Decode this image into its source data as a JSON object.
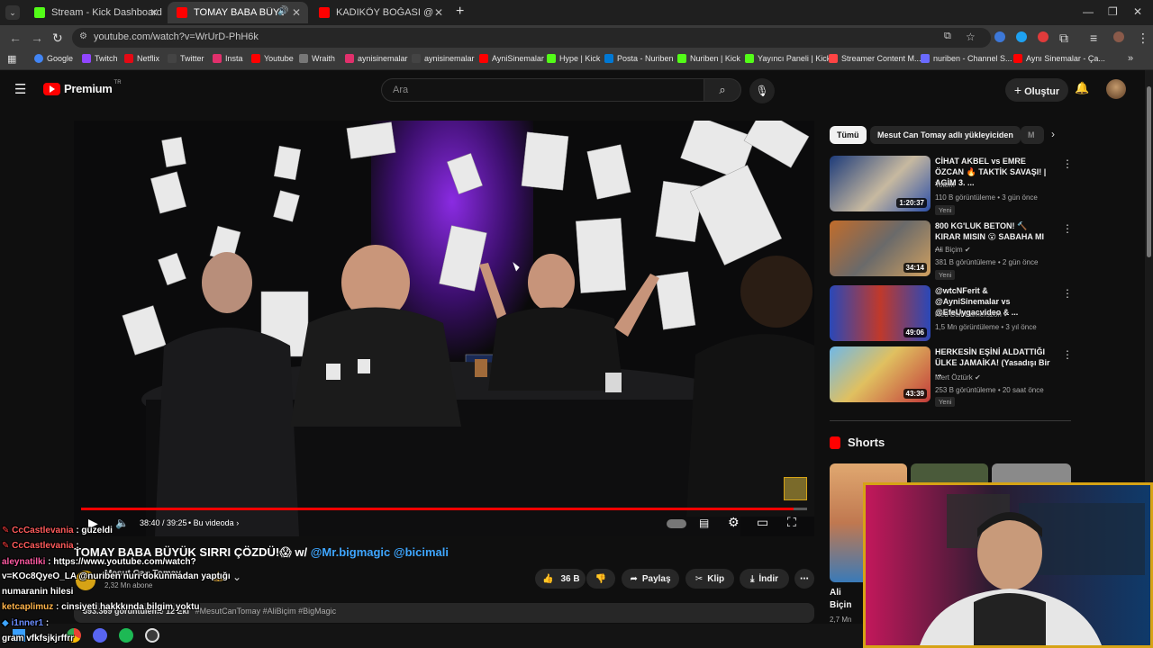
{
  "browser": {
    "tabs": [
      {
        "title": "Stream - Kick Dashboard",
        "color": "#53fc18"
      },
      {
        "title": "TOMAY BABA BÜYÜK SIRRI",
        "color": "#ff0000"
      },
      {
        "title": "KADIKÖY BOĞASI @Asitmen İl...",
        "color": "#ff0000"
      }
    ],
    "new_tab": "+",
    "url": "youtube.com/watch?v=WrUrD-PhH6k"
  },
  "bookmarks": [
    {
      "label": "Google",
      "color": "#4285f4"
    },
    {
      "label": "Twitch",
      "color": "#9146ff"
    },
    {
      "label": "Netflix",
      "color": "#e50914"
    },
    {
      "label": "Twitter",
      "color": "#dddddd"
    },
    {
      "label": "Insta",
      "color": "#e1306c"
    },
    {
      "label": "Youtube",
      "color": "#ff0000"
    },
    {
      "label": "Wraith",
      "color": "#aaaaaa"
    },
    {
      "label": "aynisinemalar",
      "color": "#e1306c"
    },
    {
      "label": "aynisinemalar",
      "color": "#dddddd"
    },
    {
      "label": "AyniSinemalar",
      "color": "#ff0000"
    },
    {
      "label": "Hype | Kick",
      "color": "#53fc18"
    },
    {
      "label": "Posta - Nuriben",
      "color": "#0078d4"
    },
    {
      "label": "Nuriben | Kick",
      "color": "#53fc18"
    },
    {
      "label": "Yayıncı Paneli | Kick",
      "color": "#53fc18"
    },
    {
      "label": "Streamer Content M...",
      "color": "#ff4444"
    },
    {
      "label": "nuriben - Channel S...",
      "color": "#6a6aff"
    },
    {
      "label": "Aynı Sinemalar - Ça...",
      "color": "#ff0000"
    }
  ],
  "youtube": {
    "logo_text": "Premium",
    "logo_super": "TR",
    "search_placeholder": "Ara",
    "create_label": "Oluştur"
  },
  "player": {
    "time": "38:40 / 39:25",
    "chapter": "Bu videoda",
    "progress_fraction": 0.981
  },
  "video": {
    "title_plain": "TOMAY BABA BÜYÜK SIRRI ÇÖZDÜ!😱 w/",
    "title_links": "@Mr.bigmagic @bicimali",
    "channel": "Mesut Can Tomay",
    "subs": "2,32 Mn abone",
    "likes": "36 B",
    "share": "Paylaş",
    "clip": "Klip",
    "download": "İndir",
    "views_date": "393.369 görüntüleme  12 Eki",
    "tags": "#MesutCanTomay #AliBiçim #BigMagic"
  },
  "sidebar": {
    "chips": [
      "Tümü",
      "Mesut Can Tomay adlı yükleyiciden",
      "M"
    ],
    "recommendations": [
      {
        "title": "CİHAT AKBEL vs EMRE ÖZCAN 🔥 TAKTİK SAVAŞI! | AGİM 3. ...",
        "channel": "Totem",
        "meta": "110 B görüntüleme • 3 gün önce",
        "badge": "Yeni",
        "duration": "1:20:37"
      },
      {
        "title": "800 KG'LUK BETON! 🔨 KIRAR MISIN 😮 SABAHA MI ...",
        "channel": "Ali Biçim ✔",
        "meta": "381 B görüntüleme • 2 gün önce",
        "badge": "Yeni",
        "duration": "34:14"
      },
      {
        "title": "@wtcNFerit & @AyniSinemalar vs @EfeUygacvideo & ...",
        "channel": "Red Bull Gamerszon ✔",
        "meta": "1,5 Mn görüntüleme • 3 yıl önce",
        "badge": "",
        "duration": "49:06"
      },
      {
        "title": "HERKESİN EŞİNİ ALDATTIĞI ÜLKE JAMAİKA! (Yasadışı Bir ...",
        "channel": "Mert Öztürk ✔",
        "meta": "253 B görüntüleme • 20 saat önce",
        "badge": "Yeni",
        "duration": "43:39"
      }
    ],
    "shorts_label": "Shorts",
    "shorts_caption": "Ali Biçin Botoksl...",
    "shorts_meta": "2,7 Mn"
  },
  "chat": [
    {
      "user": "CcCastlevania",
      "msg": ": guzeldi"
    },
    {
      "user": "CcCastlevania",
      "msg": ":"
    },
    {
      "user": "aleynatilki",
      "msg": ": https://www.youtube.com/watch?"
    },
    {
      "user": "",
      "msg": "v=KOc8QyeO_LA @nuriben nuri dokunmadan yaptığı"
    },
    {
      "user": "",
      "msg": "numaranin hilesi"
    },
    {
      "user": "ketcaplimuz",
      "msg": ": cinsiyeti hakkkında bilgim yoktu"
    },
    {
      "user": "i1nner1",
      "msg": ":"
    },
    {
      "user": "",
      "msg": "gram vfkfsjkjrffrr"
    }
  ]
}
